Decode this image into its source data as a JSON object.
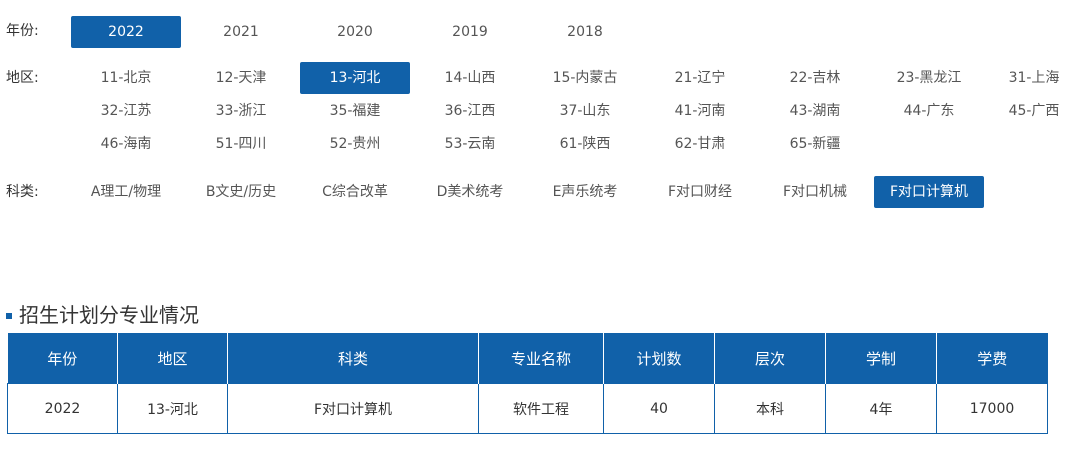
{
  "filters": {
    "year": {
      "label": "年份:",
      "options": [
        "2022",
        "2021",
        "2020",
        "2019",
        "2018"
      ],
      "selected": "2022"
    },
    "region": {
      "label": "地区:",
      "options": [
        "11-北京",
        "12-天津",
        "13-河北",
        "14-山西",
        "15-内蒙古",
        "21-辽宁",
        "22-吉林",
        "23-黑龙江",
        "31-上海",
        "32-江苏",
        "33-浙江",
        "35-福建",
        "36-江西",
        "37-山东",
        "41-河南",
        "43-湖南",
        "44-广东",
        "45-广西",
        "46-海南",
        "51-四川",
        "52-贵州",
        "53-云南",
        "61-陕西",
        "62-甘肃",
        "65-新疆"
      ],
      "selected": "13-河北"
    },
    "category": {
      "label": "科类:",
      "options": [
        "A理工/物理",
        "B文史/历史",
        "C综合改革",
        "D美术统考",
        "E声乐统考",
        "F对口财经",
        "F对口机械",
        "F对口计算机"
      ],
      "selected": "F对口计算机"
    }
  },
  "section": {
    "title": "招生计划分专业情况"
  },
  "table": {
    "headers": [
      "年份",
      "地区",
      "科类",
      "专业名称",
      "计划数",
      "层次",
      "学制",
      "学费"
    ],
    "rows": [
      [
        "2022",
        "13-河北",
        "F对口计算机",
        "软件工程",
        "40",
        "本科",
        "4年",
        "17000"
      ]
    ]
  },
  "colors": {
    "accent": "#1161a9",
    "text": "#333333"
  }
}
